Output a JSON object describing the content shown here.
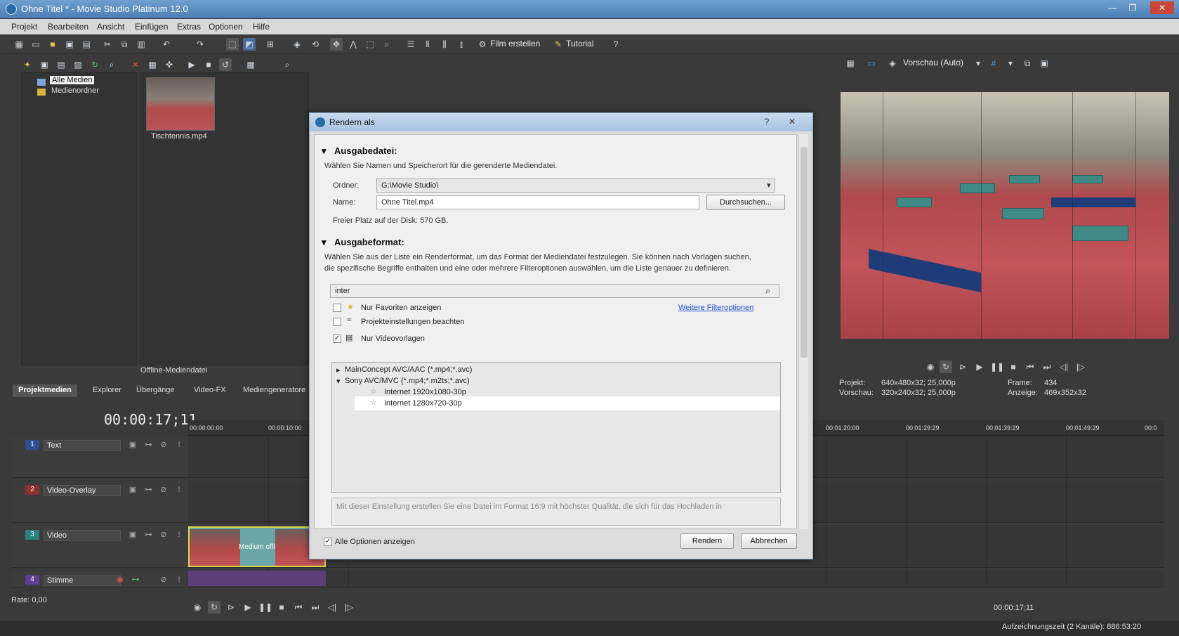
{
  "window": {
    "title": "Ohne Titel * - Movie Studio Platinum 12.0",
    "controls": {
      "minimize": "—",
      "maximize": "❐",
      "close": "✕"
    }
  },
  "menu": [
    "Projekt",
    "Bearbeiten",
    "Ansicht",
    "Einfügen",
    "Extras",
    "Optionen",
    "Hilfe"
  ],
  "toolbar": {
    "film_erstellen": "Film erstellen",
    "tutorial": "Tutorial"
  },
  "media": {
    "tree": [
      "Alle Medien",
      "Medienordner"
    ],
    "file_name": "Tischtennis.mp4",
    "offline_label": "Offline-Mediendatei",
    "tabs": [
      "Projektmedien",
      "Explorer",
      "Übergänge",
      "Video-FX",
      "Mediengeneratore"
    ]
  },
  "preview": {
    "mode": "Vorschau (Auto)",
    "projekt_label": "Projekt:",
    "projekt_value": "640x480x32; 25,000p",
    "vorschau_label": "Vorschau:",
    "vorschau_value": "320x240x32; 25,000p",
    "frame_label": "Frame:",
    "frame_value": "434",
    "anzeige_label": "Anzeige:",
    "anzeige_value": "469x352x32"
  },
  "timeline": {
    "timecode": "00:00:17;11",
    "ruler": [
      "00:00:00:00",
      "00:00:10:00",
      "00:01:20:00",
      "00:01:29:29",
      "00:01:39:29",
      "00:01:49:29",
      "00:0"
    ],
    "tracks": [
      {
        "num": "1",
        "name": "Text",
        "color": "#2f4f8f"
      },
      {
        "num": "2",
        "name": "Video-Overlay",
        "color": "#8f2f2f"
      },
      {
        "num": "3",
        "name": "Video",
        "color": "#2f7f7f"
      },
      {
        "num": "4",
        "name": "Stimme",
        "color": "#5f3f8f"
      }
    ],
    "clip_text": "Medium offline",
    "rate": "Rate: 0,00",
    "bottom_timecode": "00:00:17;11",
    "status": "Aufzeichnungszeit (2 Kanäle): 886:53:20"
  },
  "dialog": {
    "title": "Rendern als",
    "help": "?",
    "close": "✕",
    "section1_title": "Ausgabedatei:",
    "section1_text": "Wählen Sie Namen und Speicherort für die gerenderte Mediendatei.",
    "folder_label": "Ordner:",
    "folder_value": "G:\\Movie Studio\\",
    "name_label": "Name:",
    "name_value": "Ohne Titel.mp4",
    "browse": "Durchsuchen...",
    "free_space": "Freier Platz auf der Disk: 570 GB.",
    "section2_title": "Ausgabeformat:",
    "section2_text1": "Wählen Sie aus der Liste ein Renderformat, um das Format der Mediendatei festzulegen. Sie können nach Vorlagen suchen,",
    "section2_text2": "die spezifische Begriffe enthalten und eine oder mehrere Filteroptionen auswählen, um die Liste genauer zu definieren.",
    "search_value": "inter",
    "filter_fav": "Nur Favoriten anzeigen",
    "filter_project": "Projekteinstellungen beachten",
    "filter_video": "Nur Videovorlagen",
    "more_filters": "Weitere Filteroptionen",
    "format_list": {
      "group1": "MainConcept AVC/AAC (*.mp4;*.avc)",
      "group2": "Sony AVC/MVC (*.mp4;*.m2ts;*.avc)",
      "item1": "Internet 1920x1080-30p",
      "item2": "Internet 1280x720-30p"
    },
    "description": "Mit dieser Einstellung erstellen Sie eine Datei im Format 16:9 mit höchster Qualität, die sich für das Hochladen in",
    "show_all": "Alle Optionen anzeigen",
    "render": "Rendern",
    "cancel": "Abbrechen"
  }
}
